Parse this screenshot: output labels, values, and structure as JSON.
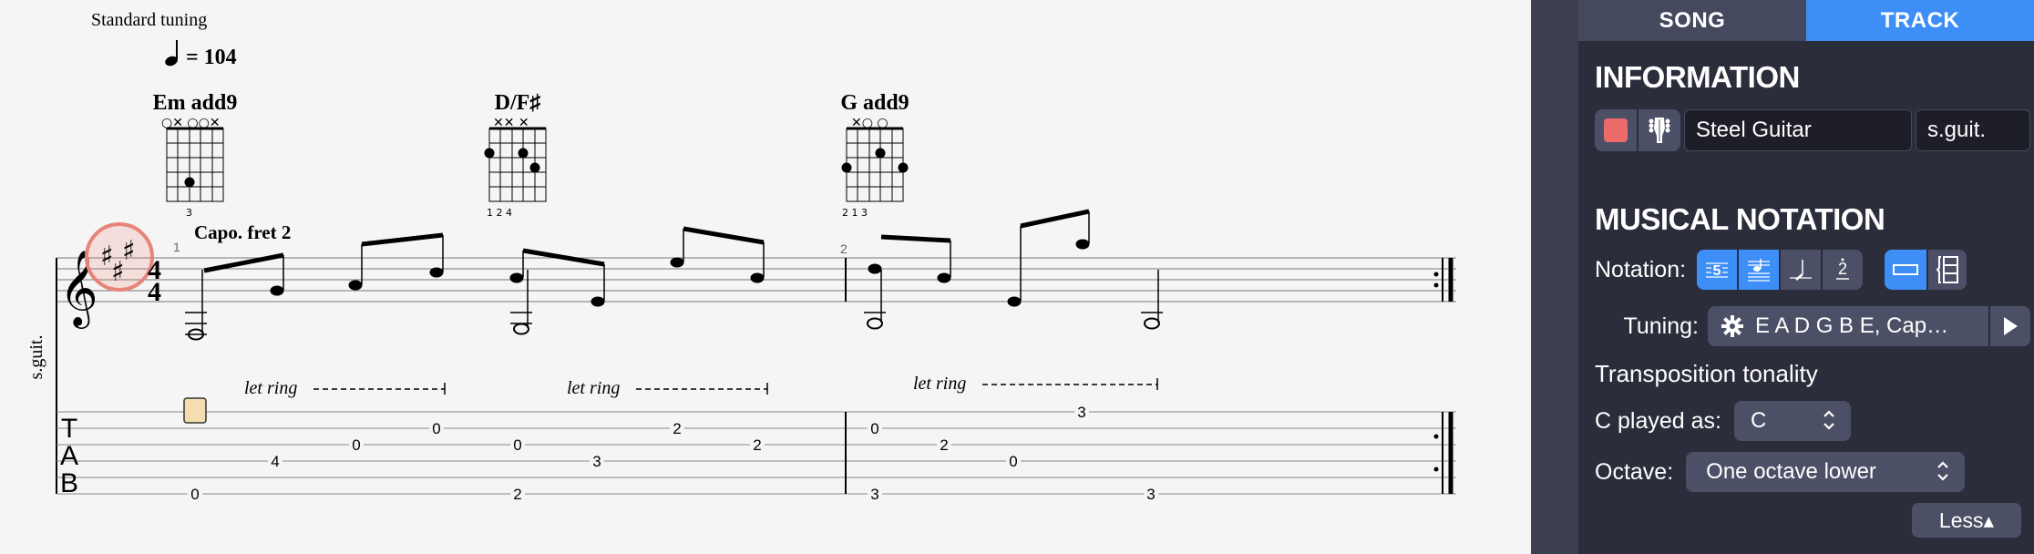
{
  "score": {
    "tuning_label": "Standard tuning",
    "tempo_value": "= 104",
    "chords": [
      {
        "name": "Em add9",
        "top_marks": "○✕  ○○✕",
        "fingers": "3"
      },
      {
        "name": "D/F♯",
        "top_marks": "✕✕    ✕",
        "fingers": "1     2 4"
      },
      {
        "name": "G add9",
        "top_marks": "✕○   ○",
        "fingers": "2     1   3"
      }
    ],
    "capo_text": "Capo. fret 2",
    "bar_numbers": [
      "1",
      "2"
    ],
    "let_ring": "let ring",
    "track_short_name": "s.guit.",
    "tab_clef": [
      "T",
      "A",
      "B"
    ],
    "time_signature": [
      "4",
      "4"
    ],
    "tab_numbers": {
      "measure1": [
        "0",
        "4",
        "0",
        "0",
        "2",
        "0",
        "3",
        "2",
        "2"
      ],
      "measure2": [
        "0",
        "2",
        "0",
        "3",
        "3",
        "3"
      ]
    }
  },
  "panel": {
    "tabs": {
      "song": "SONG",
      "track": "TRACK"
    },
    "information_title": "INFORMATION",
    "track_color": "#ee6b6b",
    "instrument_name": "Steel Guitar",
    "instrument_short": "s.guit.",
    "notation_title": "MUSICAL NOTATION",
    "notation_label": "Notation:",
    "notation_buttons": [
      "tab-icon",
      "standard-tab-icon",
      "slash-icon",
      "numbered-icon"
    ],
    "tuning_label": "Tuning:",
    "tuning_value": "E A D G B E, Cap…",
    "transposition_title": "Transposition tonality",
    "c_played_label": "C played as:",
    "c_played_value": "C",
    "octave_label": "Octave:",
    "octave_value": "One octave lower",
    "less_label": "Less▴"
  }
}
